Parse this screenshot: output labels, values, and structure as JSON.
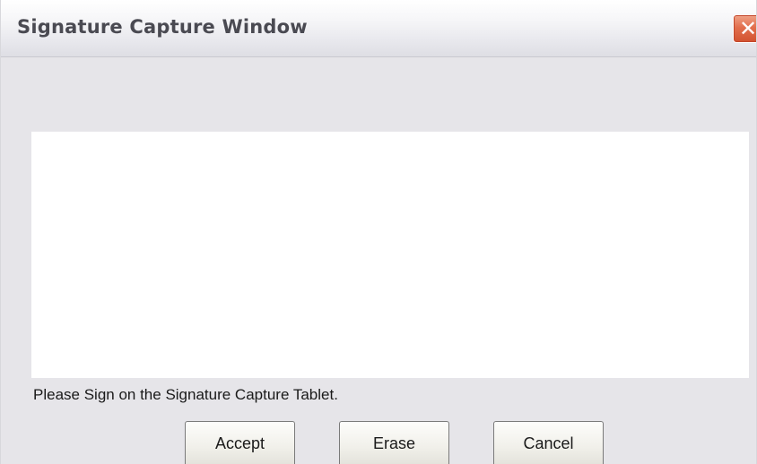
{
  "window": {
    "title": "Signature Capture Window",
    "close_icon": "close-icon"
  },
  "signature_pad": {
    "background": "#ffffff"
  },
  "instruction": "Please Sign on the Signature Capture Tablet.",
  "buttons": {
    "accept": "Accept",
    "erase": "Erase",
    "cancel": "Cancel"
  },
  "colors": {
    "window_background": "#e6e5e9",
    "close_button": "#e26f4e"
  }
}
